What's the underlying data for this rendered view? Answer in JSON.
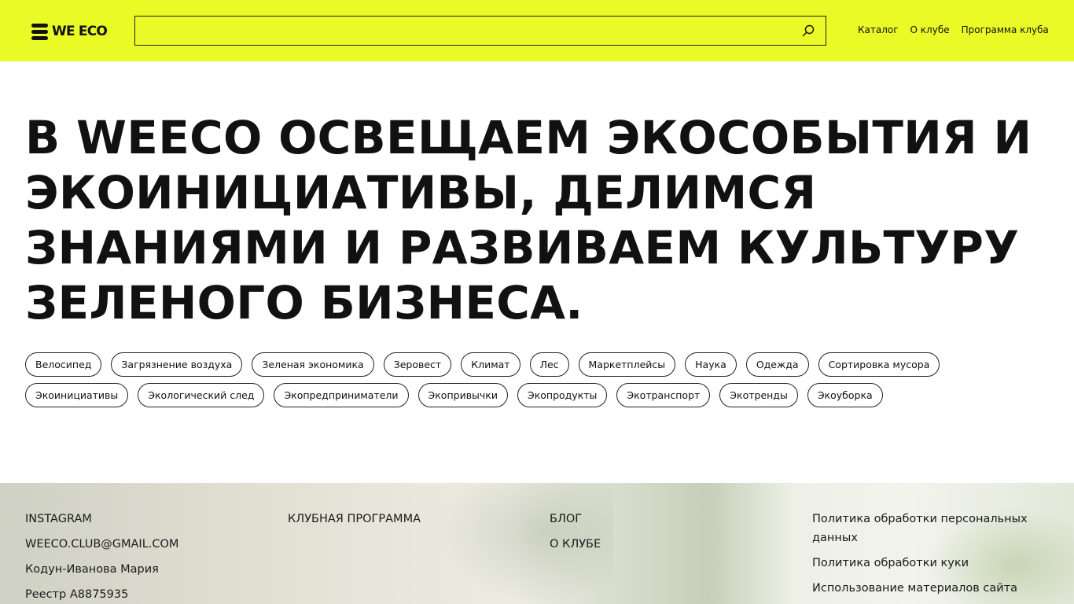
{
  "header": {
    "logo_text": "WE ECO",
    "search": {
      "value": "",
      "placeholder": ""
    },
    "nav": [
      "Каталог",
      "О клубе",
      "Программа клуба"
    ]
  },
  "hero": {
    "title": "В WEECO освещаем экособытия и экоинициативы, делимся знаниями и развиваем культуру зеленого бизнеса."
  },
  "tags": [
    "Велосипед",
    "Загрязнение воздуха",
    "Зеленая экономика",
    "Зеровест",
    "Климат",
    "Лес",
    "Маркетплейсы",
    "Наука",
    "Одежда",
    "Сортировка мусора",
    "Экоинициативы",
    "Экологический след",
    "Экопредприниматели",
    "Экопривычки",
    "Экопродукты",
    "Экотранспорт",
    "Экотренды",
    "Экоуборка"
  ],
  "footer": {
    "col1": [
      "INSTAGRAM",
      "WEECO.CLUB@GMAIL.COM",
      "Кодун-Иванова Мария",
      "Реестр А8875935"
    ],
    "col2": [
      "КЛУБНАЯ ПРОГРАММА"
    ],
    "col3": [
      "БЛОГ",
      "О КЛУБЕ"
    ],
    "col4": [
      "Политика обработки персональных данных",
      "Политика обработки куки",
      "Использование материалов сайта"
    ]
  },
  "colors": {
    "accent": "#e9fa27",
    "text": "#111111"
  },
  "icons": {
    "logo": "stacked-bars-logo-icon",
    "search": "search-icon"
  }
}
